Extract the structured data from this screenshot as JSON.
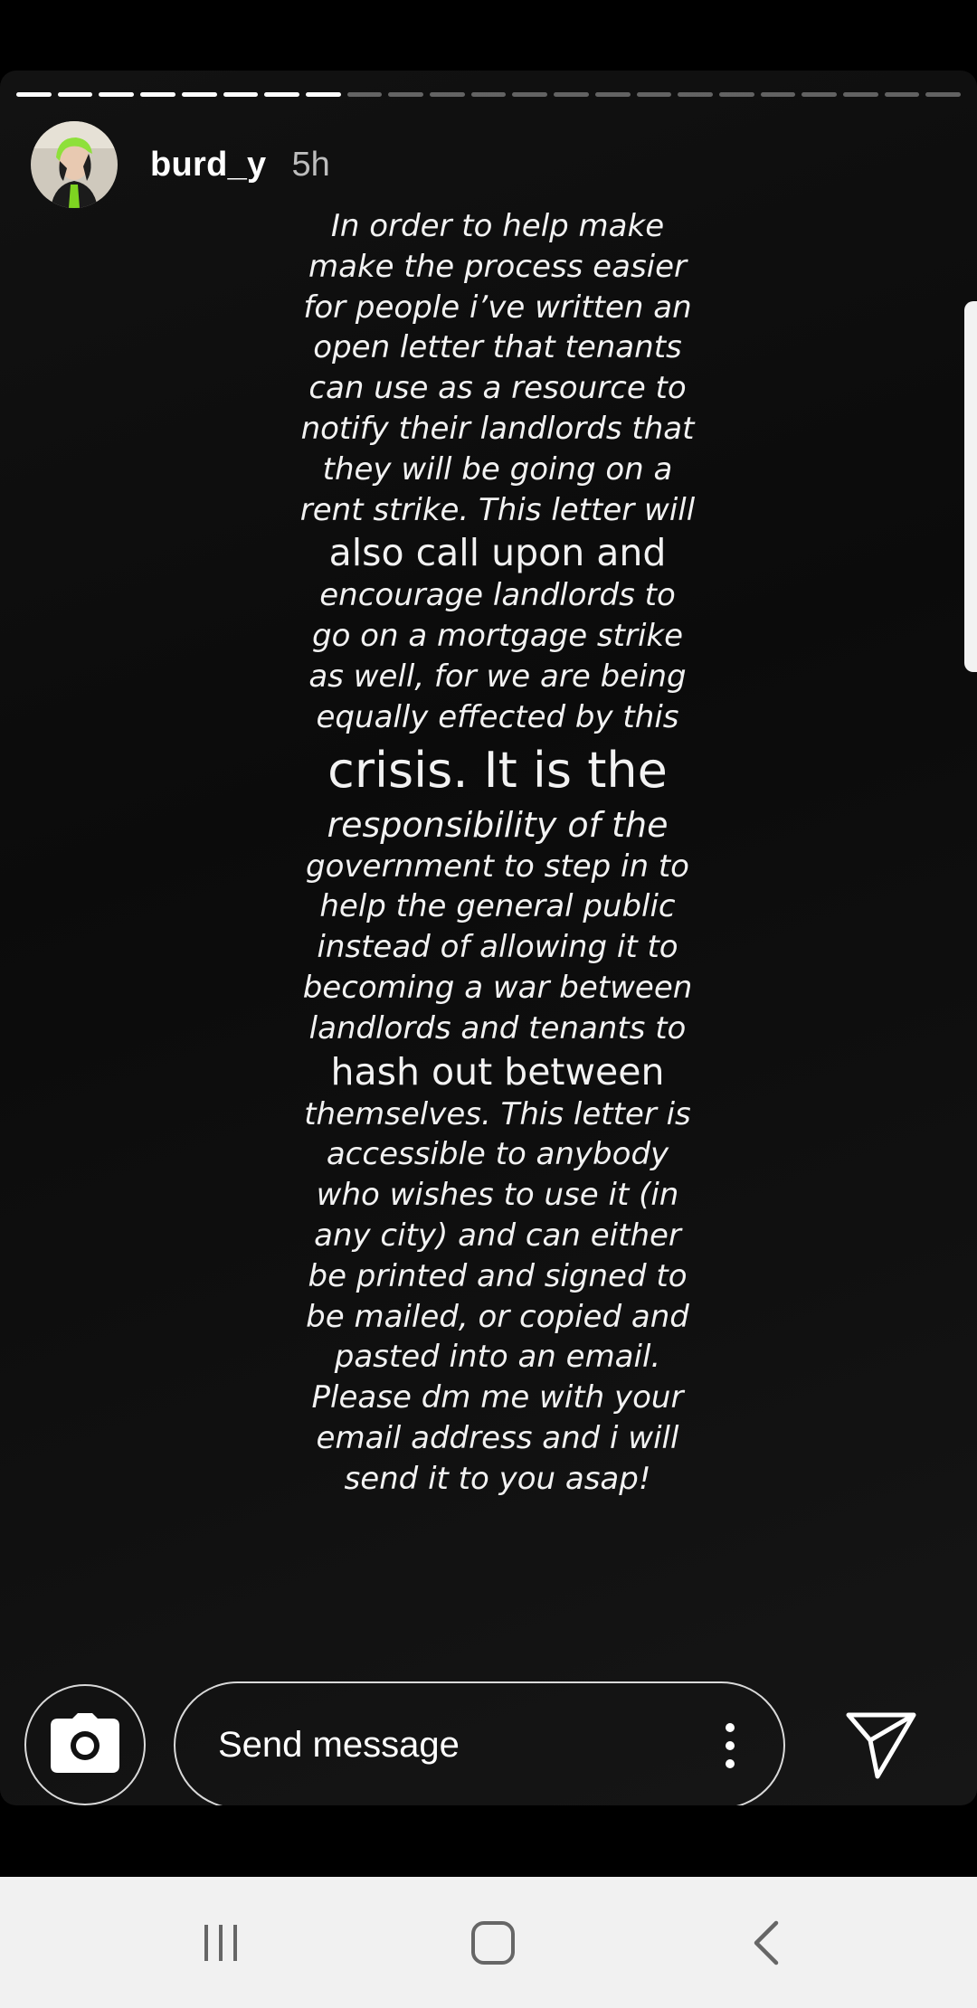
{
  "story": {
    "username": "burd_y",
    "timestamp": "5h",
    "progress": {
      "total_segments": 23,
      "completed_segments": 8
    },
    "lines": [
      {
        "text": "In order to help make",
        "style": "normal"
      },
      {
        "text": "make the process easier",
        "style": "normal"
      },
      {
        "text": "for people i’ve written an",
        "style": "normal"
      },
      {
        "text": "open letter that tenants",
        "style": "normal"
      },
      {
        "text": "can use as a resource to",
        "style": "normal"
      },
      {
        "text": "notify their landlords that",
        "style": "normal"
      },
      {
        "text": "they will be going on a",
        "style": "normal"
      },
      {
        "text": "rent strike. This letter will",
        "style": "normal"
      },
      {
        "text": "also call upon and",
        "style": "big"
      },
      {
        "text": "encourage landlords to",
        "style": "normal"
      },
      {
        "text": "go on a mortgage strike",
        "style": "normal"
      },
      {
        "text": "as well, for we are being",
        "style": "normal"
      },
      {
        "text": "equally effected by this",
        "style": "normal"
      },
      {
        "text": "crisis. It is the",
        "style": "huge"
      },
      {
        "text": "responsibility of the",
        "style": "mid"
      },
      {
        "text": "government to step in to",
        "style": "normal"
      },
      {
        "text": "help the general public",
        "style": "normal"
      },
      {
        "text": "instead of allowing it to",
        "style": "normal"
      },
      {
        "text": "becoming a war between",
        "style": "normal"
      },
      {
        "text": "landlords and tenants to",
        "style": "normal"
      },
      {
        "text": "hash out between",
        "style": "big"
      },
      {
        "text": "themselves. This letter is",
        "style": "normal"
      },
      {
        "text": "accessible to anybody",
        "style": "normal"
      },
      {
        "text": "who wishes to use it (in",
        "style": "normal"
      },
      {
        "text": "any city) and can either",
        "style": "normal"
      },
      {
        "text": "be printed and signed to",
        "style": "normal"
      },
      {
        "text": "be mailed, or copied and",
        "style": "normal"
      },
      {
        "text": "pasted into an email.",
        "style": "normal"
      },
      {
        "text": "Please dm me with your",
        "style": "normal"
      },
      {
        "text": "email address and i will",
        "style": "normal"
      },
      {
        "text": "send it to you asap!",
        "style": "normal"
      }
    ]
  },
  "reply_bar": {
    "placeholder": "Send message",
    "camera_icon": "camera-icon",
    "more_icon": "more-vertical-icon",
    "send_icon": "send-icon"
  },
  "nav": {
    "recents_icon": "recent-apps-icon",
    "home_icon": "home-icon",
    "back_icon": "back-icon"
  },
  "colors": {
    "background": "#000000",
    "text": "#f2f2f2",
    "progress_done": "#ffffff",
    "nav_bar": "#f1f1f1"
  }
}
